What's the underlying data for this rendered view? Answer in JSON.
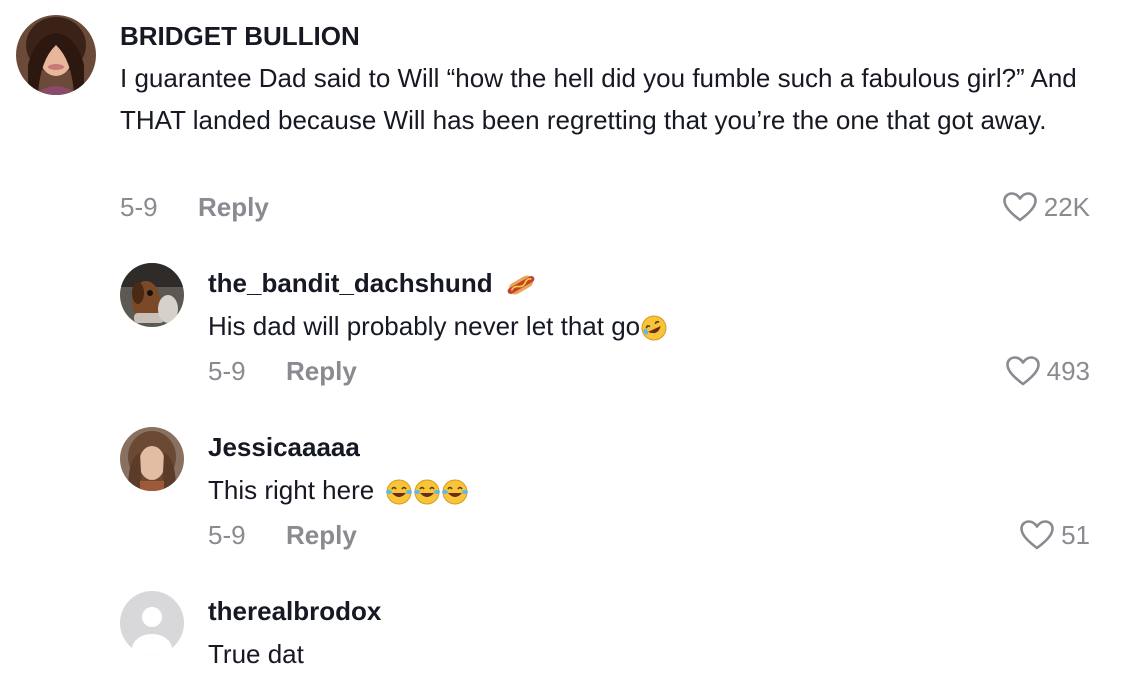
{
  "comments": [
    {
      "username": "BRIDGET BULLION",
      "text": "I guarantee Dad said to Will “how the hell did you fumble such a fabulous girl?” And THAT landed because Will has been regretting that you’re the one that got away.",
      "date": "5-9",
      "reply_label": "Reply",
      "likes": "22K"
    },
    {
      "username": "the_bandit_dachshund",
      "username_emoji": "hotdog",
      "text": "His dad will probably never let that go",
      "text_emoji": "rofl",
      "date": "5-9",
      "reply_label": "Reply",
      "likes": "493"
    },
    {
      "username": "Jessicaaaaa",
      "text": "This right here",
      "text_emoji": "joy x3",
      "date": "5-9",
      "reply_label": "Reply",
      "likes": "51"
    },
    {
      "username": "therealbrodox",
      "text": "True dat"
    }
  ],
  "colors": {
    "text": "#161823",
    "muted": "#8a8b91",
    "background": "#ffffff"
  }
}
